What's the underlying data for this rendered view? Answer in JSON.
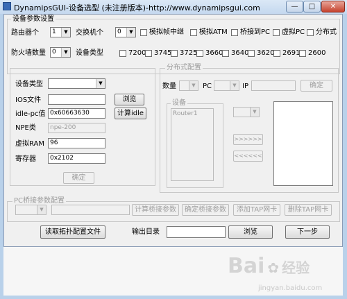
{
  "window": {
    "title": "DynamipsGUI-设备选型 (未注册版本)-http://www.dynamipsgui.com",
    "min_glyph": "—",
    "max_glyph": "□",
    "close_glyph": "✕"
  },
  "device_params": {
    "group_title": "设备参数设置",
    "router_count_label": "路由器个",
    "router_count_value": "1",
    "switch_count_label": "交换机个",
    "switch_count_value": "0",
    "checkboxes": [
      "模拟帧中继",
      "模拟ATM",
      "桥接到PC",
      "虚拟PC",
      "分布式"
    ],
    "firewall_count_label": "防火墙数量",
    "firewall_count_value": "0",
    "device_type_label": "设备类型",
    "device_models": [
      "7200",
      "3745",
      "3725",
      "3660",
      "3640",
      "3620",
      "2691",
      "2600"
    ]
  },
  "router_config": {
    "device_type_label": "设备类型",
    "device_type_value": "",
    "ios_label": "IOS文件",
    "ios_value": "",
    "browse_label": "浏览",
    "idlepc_label": "idle-pc值",
    "idlepc_value": "0x60663630",
    "calc_idle_label": "计算idle",
    "npe_label": "NPE类",
    "npe_value": "npe-200",
    "ram_label": "虚拟RAM",
    "ram_value": "96",
    "register_label": "寄存器",
    "register_value": "0x2102",
    "confirm_label": "确定"
  },
  "distributed": {
    "group_title": "分布式配置",
    "count_label": "数量",
    "pc_label": "PC",
    "ip_label": "IP",
    "confirm_label": "确定",
    "device_group_title": "设备",
    "devices": [
      "Router1"
    ],
    "forward_label": ">>>>>>",
    "back_label": "<<<<<<"
  },
  "pc_bridge": {
    "group_title": "PC桥接参数配置",
    "calc_label": "计算桥接参数",
    "confirm_label": "确定桥接参数",
    "add_tap_label": "添加TAP网卡",
    "delete_tap_label": "删除TAP网卡"
  },
  "bottom": {
    "read_topology_label": "读取拓扑配置文件",
    "output_dir_label": "输出目录",
    "output_dir_value": "",
    "browse_label": "浏览",
    "next_label": "下一步"
  },
  "watermark": {
    "brand": "Bai",
    "brand2": "经验",
    "url": "jingyan.baidu.com"
  }
}
